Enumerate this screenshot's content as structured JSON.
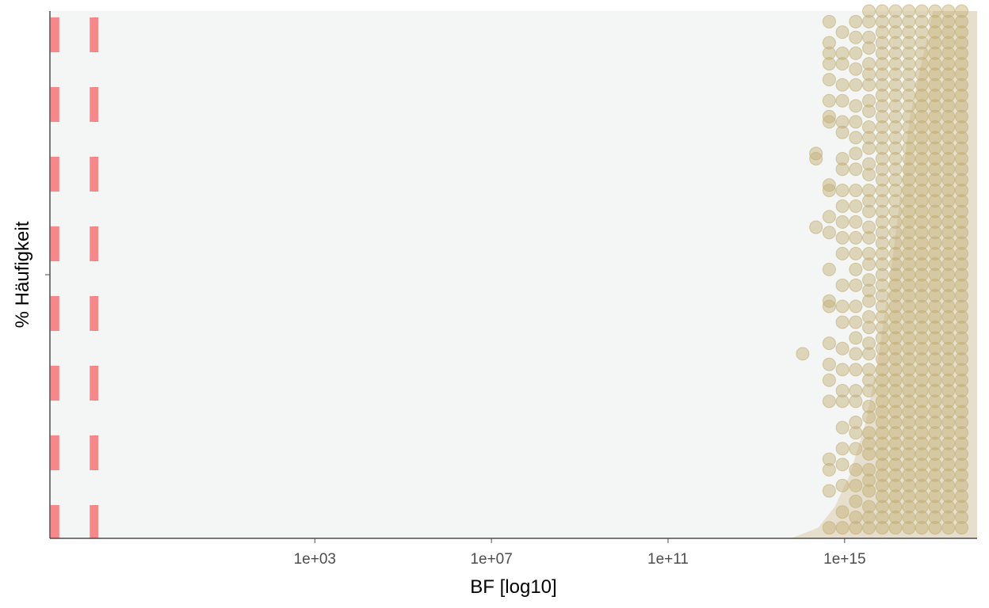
{
  "chart_data": {
    "type": "scatter",
    "title": "",
    "xlabel": "BF [log10]",
    "ylabel": "% Häufigkeit",
    "x_scale": "log10",
    "xlim": [
      0.001,
      1e+18
    ],
    "x_ticks": [
      {
        "value": 1000.0,
        "label": "1e+03"
      },
      {
        "value": 10000000.0,
        "label": "1e+07"
      },
      {
        "value": 100000000000.0,
        "label": "1e+11"
      },
      {
        "value": 1000000000000000.0,
        "label": "1e+15"
      }
    ],
    "ylim": [
      0,
      1
    ],
    "y_tick_labels": [],
    "grid": false,
    "panel_background": "#f4f6f6",
    "reference_lines": [
      {
        "x": 0.0013,
        "style": "dashed",
        "color": "#f8878a"
      },
      {
        "x": 0.01,
        "style": "dashed",
        "color": "#f8878a"
      }
    ],
    "point_color": "#c2ad72",
    "density_color": "#e3dac6",
    "series": [
      {
        "columns": [
          {
            "x": 112000000000000.0,
            "y": [
              0.35
            ]
          },
          {
            "x": 224000000000000.0,
            "y": [
              0.59,
              0.72,
              0.73
            ]
          },
          {
            "x": 447000000000000.0,
            "y": [
              0.15,
              0.02,
              0.09,
              0.13,
              0.26,
              0.3,
              0.33,
              0.37,
              0.44,
              0.45,
              0.51,
              0.58,
              0.61,
              0.66,
              0.67,
              0.79,
              0.8,
              0.83,
              0.87,
              0.9,
              0.92,
              0.94,
              0.98
            ]
          },
          {
            "x": 890000000000000.0,
            "y": [
              0.02,
              0.05,
              0.1,
              0.14,
              0.17,
              0.21,
              0.26,
              0.28,
              0.32,
              0.36,
              0.41,
              0.44,
              0.48,
              0.54,
              0.57,
              0.6,
              0.63,
              0.66,
              0.7,
              0.72,
              0.77,
              0.79,
              0.83,
              0.86,
              0.9,
              0.92,
              0.96
            ]
          },
          {
            "x": 1780000000000000.0,
            "y": [
              0.02,
              0.04,
              0.07,
              0.1,
              0.13,
              0.17,
              0.2,
              0.22,
              0.26,
              0.28,
              0.32,
              0.35,
              0.38,
              0.41,
              0.44,
              0.48,
              0.51,
              0.54,
              0.57,
              0.6,
              0.63,
              0.66,
              0.7,
              0.73,
              0.76,
              0.79,
              0.82,
              0.86,
              0.89,
              0.92,
              0.95,
              0.98
            ]
          },
          {
            "x": 3550000000000000.0,
            "y": [
              0.02,
              0.04,
              0.06,
              0.09,
              0.11,
              0.13,
              0.16,
              0.18,
              0.2,
              0.23,
              0.25,
              0.28,
              0.3,
              0.32,
              0.35,
              0.37,
              0.4,
              0.42,
              0.45,
              0.47,
              0.49,
              0.52,
              0.54,
              0.57,
              0.59,
              0.62,
              0.64,
              0.66,
              0.69,
              0.71,
              0.74,
              0.76,
              0.78,
              0.81,
              0.83,
              0.86,
              0.88,
              0.9,
              0.93,
              0.95,
              0.98,
              1.0
            ]
          },
          {
            "x": 7100000000000000.0,
            "y": [
              0.02,
              0.04,
              0.06,
              0.08,
              0.1,
              0.12,
              0.14,
              0.16,
              0.18,
              0.2,
              0.22,
              0.24,
              0.26,
              0.28,
              0.3,
              0.32,
              0.34,
              0.36,
              0.38,
              0.4,
              0.42,
              0.44,
              0.46,
              0.48,
              0.5,
              0.52,
              0.54,
              0.56,
              0.58,
              0.6,
              0.62,
              0.64,
              0.66,
              0.68,
              0.7,
              0.72,
              0.74,
              0.76,
              0.78,
              0.8,
              0.82,
              0.84,
              0.86,
              0.88,
              0.9,
              0.92,
              0.94,
              0.96,
              0.98,
              1.0
            ]
          },
          {
            "x": 1.42e+16,
            "y": [
              0.02,
              0.04,
              0.06,
              0.08,
              0.1,
              0.12,
              0.14,
              0.16,
              0.18,
              0.2,
              0.22,
              0.24,
              0.26,
              0.28,
              0.3,
              0.32,
              0.34,
              0.36,
              0.38,
              0.4,
              0.42,
              0.44,
              0.46,
              0.48,
              0.5,
              0.52,
              0.54,
              0.56,
              0.58,
              0.6,
              0.62,
              0.64,
              0.66,
              0.68,
              0.7,
              0.72,
              0.74,
              0.76,
              0.78,
              0.8,
              0.82,
              0.84,
              0.86,
              0.88,
              0.9,
              0.92,
              0.94,
              0.96,
              0.98,
              1.0
            ]
          },
          {
            "x": 2.84e+16,
            "y": [
              0.02,
              0.04,
              0.06,
              0.08,
              0.1,
              0.12,
              0.14,
              0.16,
              0.18,
              0.2,
              0.22,
              0.24,
              0.26,
              0.28,
              0.3,
              0.32,
              0.34,
              0.36,
              0.38,
              0.4,
              0.42,
              0.44,
              0.46,
              0.48,
              0.5,
              0.52,
              0.54,
              0.56,
              0.58,
              0.6,
              0.62,
              0.64,
              0.66,
              0.68,
              0.7,
              0.72,
              0.74,
              0.76,
              0.78,
              0.8,
              0.82,
              0.84,
              0.86,
              0.88,
              0.9,
              0.92,
              0.94,
              0.96,
              0.98,
              1.0
            ]
          },
          {
            "x": 5.6e+16,
            "y": [
              0.02,
              0.04,
              0.06,
              0.08,
              0.1,
              0.12,
              0.14,
              0.16,
              0.18,
              0.2,
              0.22,
              0.24,
              0.26,
              0.28,
              0.3,
              0.32,
              0.34,
              0.36,
              0.38,
              0.4,
              0.42,
              0.44,
              0.46,
              0.48,
              0.5,
              0.52,
              0.54,
              0.56,
              0.58,
              0.6,
              0.62,
              0.64,
              0.66,
              0.68,
              0.7,
              0.72,
              0.74,
              0.76,
              0.78,
              0.8,
              0.82,
              0.84,
              0.86,
              0.88,
              0.9,
              0.92,
              0.94,
              0.96,
              0.98,
              1.0
            ]
          },
          {
            "x": 1.12e+17,
            "y": [
              0.02,
              0.04,
              0.06,
              0.08,
              0.1,
              0.12,
              0.14,
              0.16,
              0.18,
              0.2,
              0.22,
              0.24,
              0.26,
              0.28,
              0.3,
              0.32,
              0.34,
              0.36,
              0.38,
              0.4,
              0.42,
              0.44,
              0.46,
              0.48,
              0.5,
              0.52,
              0.54,
              0.56,
              0.58,
              0.6,
              0.62,
              0.64,
              0.66,
              0.68,
              0.7,
              0.72,
              0.74,
              0.76,
              0.78,
              0.8,
              0.82,
              0.84,
              0.86,
              0.88,
              0.9,
              0.92,
              0.94,
              0.96,
              0.98,
              1.0
            ]
          },
          {
            "x": 2.24e+17,
            "y": [
              0.02,
              0.04,
              0.06,
              0.08,
              0.1,
              0.12,
              0.14,
              0.16,
              0.18,
              0.2,
              0.22,
              0.24,
              0.26,
              0.28,
              0.3,
              0.32,
              0.34,
              0.36,
              0.38,
              0.4,
              0.42,
              0.44,
              0.46,
              0.48,
              0.5,
              0.52,
              0.54,
              0.56,
              0.58,
              0.6,
              0.62,
              0.64,
              0.66,
              0.68,
              0.7,
              0.72,
              0.74,
              0.76,
              0.78,
              0.8,
              0.82,
              0.84,
              0.86,
              0.88,
              0.9,
              0.92,
              0.94,
              0.96,
              0.98,
              1.0
            ]
          },
          {
            "x": 4.47e+17,
            "y": [
              0.02,
              0.04,
              0.06,
              0.08,
              0.1,
              0.12,
              0.14,
              0.16,
              0.18,
              0.2,
              0.22,
              0.24,
              0.26,
              0.28,
              0.3,
              0.32,
              0.34,
              0.36,
              0.38,
              0.4,
              0.42,
              0.44,
              0.46,
              0.48,
              0.5,
              0.52,
              0.54,
              0.56,
              0.58,
              0.6,
              0.62,
              0.64,
              0.66,
              0.68,
              0.7,
              0.72,
              0.74,
              0.76,
              0.78,
              0.8,
              0.82,
              0.84,
              0.86,
              0.88,
              0.9,
              0.92,
              0.94,
              0.96,
              0.98,
              1.0
            ]
          }
        ]
      }
    ]
  }
}
